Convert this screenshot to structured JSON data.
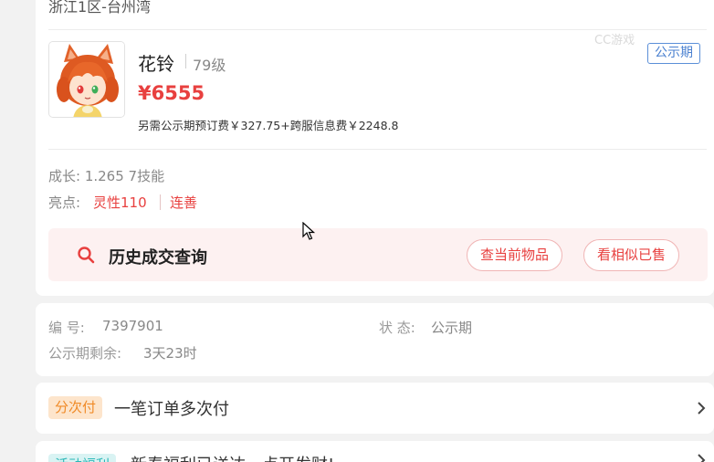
{
  "listing": {
    "server": "浙江1区-台州湾",
    "character_name": "花铃",
    "level": "79级",
    "price": "¥6555",
    "fees": "另需公示期预订费￥327.75+跨服信息费￥2248.8",
    "status_badge": "公示期",
    "watermark": "CC游戏"
  },
  "attributes": {
    "growth": "成长: 1.265 7技能",
    "highlights_label": "亮点:",
    "highlights": [
      "灵性110",
      "连善"
    ]
  },
  "history": {
    "title": "历史成交查询",
    "current_items_button": "查当前物品",
    "similar_sold_button": "看相似已售"
  },
  "info": {
    "id_label": "编 号:",
    "id_value": "7397901",
    "status_label": "状 态:",
    "status_value": "公示期",
    "remaining_label": "公示期剩余:",
    "remaining_value": "3天23时"
  },
  "payment": {
    "tag": "分次付",
    "text": "一笔订单多次付"
  },
  "promo": {
    "tag": "活动福利",
    "text": "新春福利已送达，点开发财!"
  },
  "colors": {
    "price_red": "#e8403f",
    "badge_blue": "#4a80d0",
    "pay_orange": "#f08a26",
    "promo_teal": "#2bb7b7",
    "history_bg": "#fdf1f1"
  },
  "icons": [
    "search-icon",
    "chevron-right-icon",
    "cursor-arrow-icon",
    "character-avatar"
  ]
}
